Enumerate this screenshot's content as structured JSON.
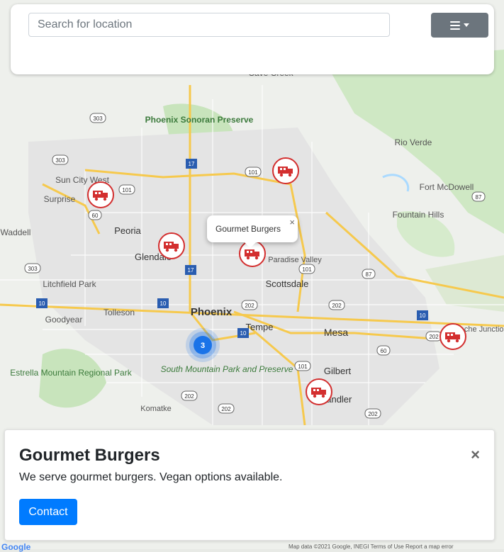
{
  "search": {
    "placeholder": "Search for location"
  },
  "menu": {
    "icon": "bars-icon"
  },
  "map": {
    "place_labels": [
      "Cave Creek",
      "Phoenix Sonoran Preserve",
      "Rio Verde",
      "Sun City West",
      "Surprise",
      "Fountain Hills",
      "Fort McDowell",
      "Peoria",
      "Glendale",
      "Paradise Valley",
      "Scottsdale",
      "Waddell",
      "Litchfield Park",
      "Tolleson",
      "Phoenix",
      "Goodyear",
      "Tempe",
      "Mesa",
      "Apache Junction",
      "Estrella Mountain Regional Park",
      "South Mountain Park and Preserve",
      "Gilbert",
      "Chandler",
      "Komatke"
    ],
    "route_shields": [
      "303",
      "303",
      "17",
      "101",
      "101",
      "87",
      "303",
      "60",
      "17",
      "101",
      "87",
      "10",
      "10",
      "202",
      "202",
      "10",
      "10",
      "60",
      "202",
      "101",
      "202",
      "202",
      "202"
    ],
    "cluster_count": "3",
    "marker_icon": "food-truck-icon",
    "colors": {
      "marker": "#d32f2f",
      "cluster": "#1a73e8",
      "contact_button": "#007bff",
      "menu_button": "#6c757d"
    }
  },
  "popup": {
    "title": "Gourmet Burgers",
    "close": "×"
  },
  "detail": {
    "title": "Gourmet Burgers",
    "description": "We serve gourmet burgers. Vegan options available.",
    "close": "×",
    "contact_label": "Contact"
  },
  "footer": {
    "text": "Map data ©2021 Google, INEGI    Terms of Use    Report a map error"
  },
  "google_logo": "Google"
}
